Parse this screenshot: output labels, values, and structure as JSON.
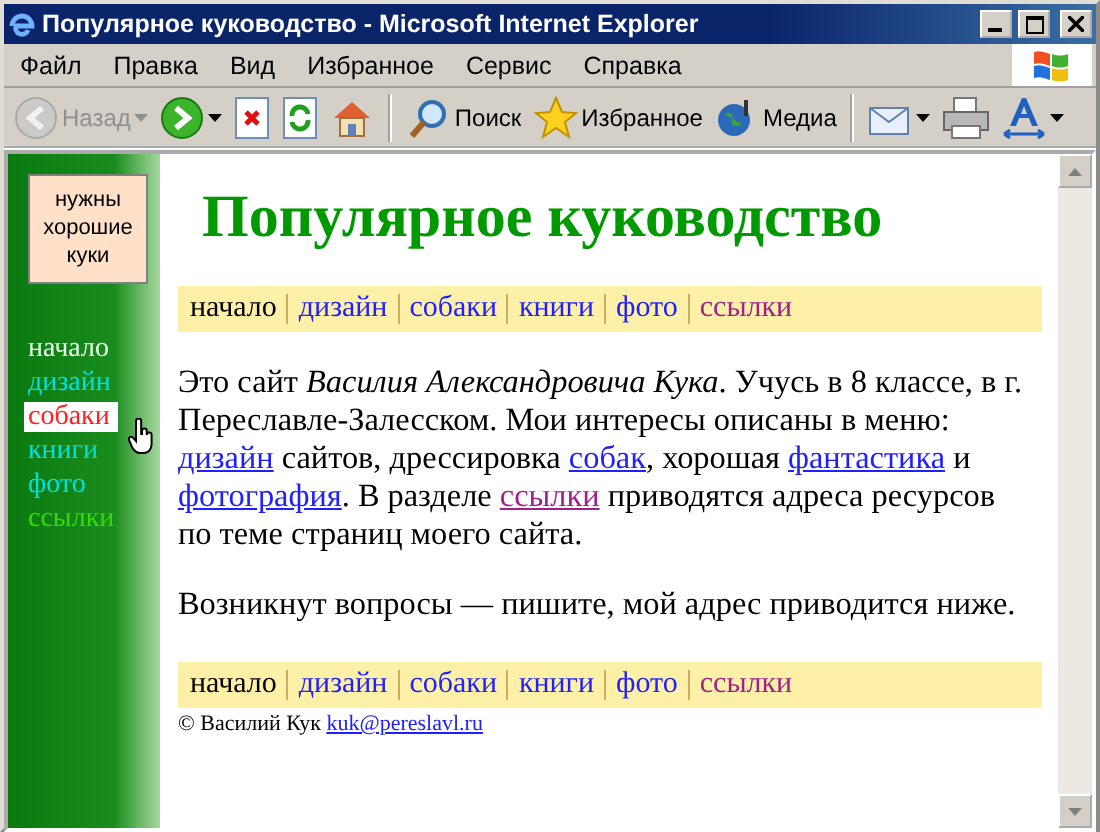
{
  "window": {
    "title": "Популярное куководство - Microsoft Internet Explorer"
  },
  "menu": [
    "Файл",
    "Правка",
    "Вид",
    "Избранное",
    "Сервис",
    "Справка"
  ],
  "toolbar": [
    {
      "kind": "back",
      "label": "Назад",
      "disabled": true
    },
    {
      "kind": "forward",
      "disabled": false
    },
    {
      "kind": "stop",
      "disabled": false
    },
    {
      "kind": "refresh",
      "disabled": false
    },
    {
      "kind": "home",
      "disabled": false
    },
    {
      "kind": "search",
      "label": "Поиск",
      "disabled": false
    },
    {
      "kind": "favorites",
      "label": "Избранное",
      "disabled": false
    },
    {
      "kind": "media",
      "label": "Медиа",
      "disabled": false
    },
    {
      "kind": "mail",
      "disabled": false
    },
    {
      "kind": "print",
      "disabled": false
    },
    {
      "kind": "font",
      "disabled": false
    }
  ],
  "sidebar": {
    "badge": "нужны хорошие куки",
    "items": [
      {
        "label": "начало",
        "color": "#e8ffe8",
        "hovered": false
      },
      {
        "label": "дизайн",
        "color": "#00e0e0",
        "hovered": false
      },
      {
        "label": "собаки",
        "color": "#ff2020",
        "hovered": true
      },
      {
        "label": "книги",
        "color": "#00e0e0",
        "hovered": false
      },
      {
        "label": "фото",
        "color": "#00e0e0",
        "hovered": false
      },
      {
        "label": "ссылки",
        "color": "#33dd00",
        "hovered": false
      }
    ]
  },
  "page": {
    "heading": "Популярное куководство",
    "nav_top": [
      {
        "label": "начало",
        "kind": "current"
      },
      {
        "label": "дизайн",
        "kind": "link"
      },
      {
        "label": "собаки",
        "kind": "link"
      },
      {
        "label": "книги",
        "kind": "link"
      },
      {
        "label": "фото",
        "kind": "link"
      },
      {
        "label": "ссылки",
        "kind": "visited"
      }
    ],
    "paragraphs": [
      [
        {
          "text": "Это сайт ",
          "kind": "plain"
        },
        {
          "text": "Василия Александровича Кука",
          "kind": "italic"
        },
        {
          "text": ". Учусь в 8 классе, в г. Переславле-Залесском. Мои интересы описаны в меню: ",
          "kind": "plain"
        },
        {
          "text": "дизайн",
          "kind": "link"
        },
        {
          "text": " сайтов, дрессировка ",
          "kind": "plain"
        },
        {
          "text": "собак",
          "kind": "link"
        },
        {
          "text": ", хорошая ",
          "kind": "plain"
        },
        {
          "text": "фантастика",
          "kind": "link"
        },
        {
          "text": " и ",
          "kind": "plain"
        },
        {
          "text": "фотография",
          "kind": "link"
        },
        {
          "text": ". В разделе ",
          "kind": "plain"
        },
        {
          "text": "ссылки",
          "kind": "visited"
        },
        {
          "text": " приводятся адреса ресурсов по теме страниц моего сайта.",
          "kind": "plain"
        }
      ],
      [
        {
          "text": "Возникнут вопросы — пишите, мой адрес приводится ниже.",
          "kind": "plain"
        }
      ]
    ],
    "nav_bottom": [
      {
        "label": "начало",
        "kind": "current"
      },
      {
        "label": "дизайн",
        "kind": "link"
      },
      {
        "label": "собаки",
        "kind": "link"
      },
      {
        "label": "книги",
        "kind": "link"
      },
      {
        "label": "фото",
        "kind": "link"
      },
      {
        "label": "ссылки",
        "kind": "visited"
      }
    ],
    "footer": {
      "text": "© Василий Кук",
      "email": "kuk@pereslavl.ru"
    }
  }
}
